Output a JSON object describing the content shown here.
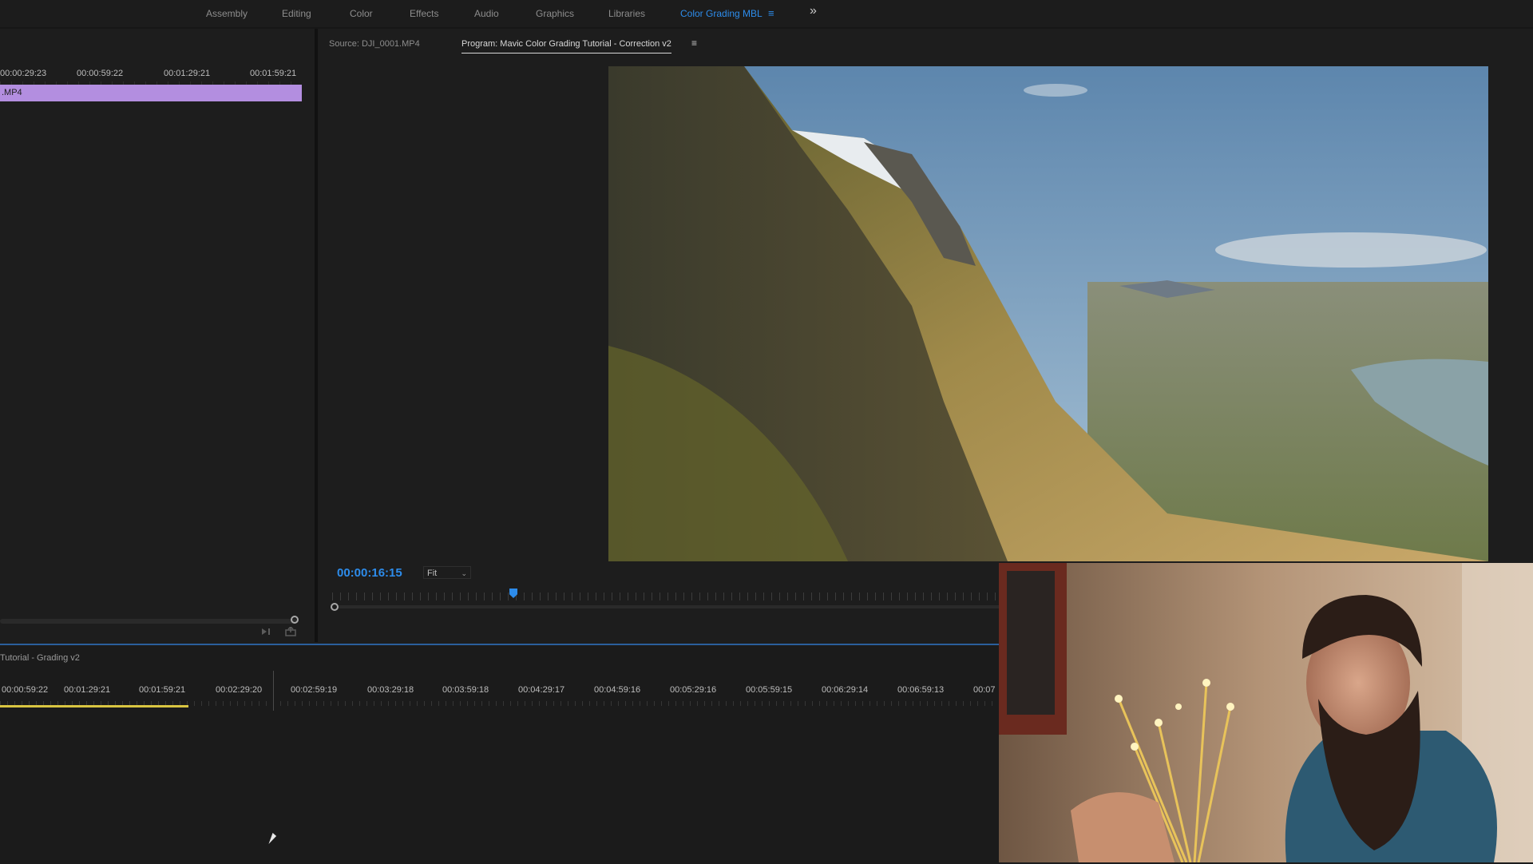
{
  "workspace_tabs": [
    "Assembly",
    "Editing",
    "Color",
    "Effects",
    "Audio",
    "Graphics",
    "Libraries",
    "Color Grading MBL"
  ],
  "workspace_menu_icon": "≡",
  "workspace_more_icon": "»",
  "source": {
    "ticks": [
      "00:00:29:23",
      "00:00:59:22",
      "00:01:29:21",
      "00:01:59:21"
    ],
    "clip_label": ".MP4"
  },
  "monitor": {
    "source_tab": "Source: DJI_0001.MP4",
    "program_tab": "Program: Mavic Color Grading Tutorial - Correction v2",
    "tab_menu_icon": "≡",
    "timecode": "00:00:16:15",
    "fit": "Fit"
  },
  "timeline": {
    "sequence_title": "Tutorial - Grading v2",
    "ticks": [
      "00:00:59:22",
      "00:01:29:21",
      "00:01:59:21",
      "00:02:29:20",
      "00:02:59:19",
      "00:03:29:18",
      "00:03:59:18",
      "00:04:29:17",
      "00:04:59:16",
      "00:05:29:16",
      "00:05:59:15",
      "00:06:29:14",
      "00:06:59:13",
      "00:07"
    ]
  },
  "colors": {
    "accent": "#2d8ceb",
    "clip": "#b38ee0",
    "work_area": "#d9c541"
  }
}
